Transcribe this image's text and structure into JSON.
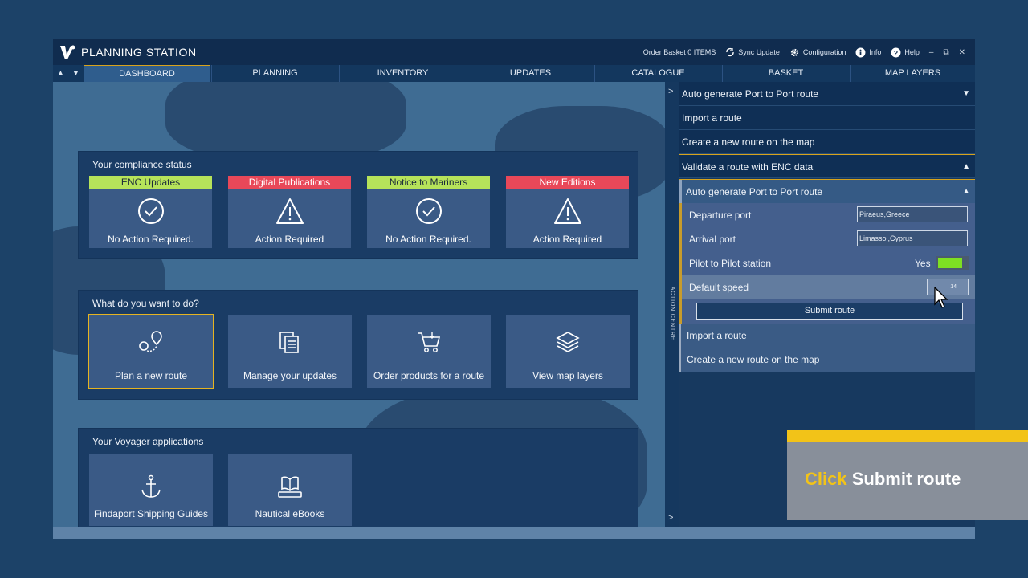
{
  "app": {
    "title": "PLANNING STATION"
  },
  "titlebar": {
    "order_basket": "Order Basket 0 ITEMS",
    "sync": "Sync Update",
    "config": "Configuration",
    "info": "Info",
    "help": "Help",
    "min": "–",
    "restore": "⧉",
    "close": "✕"
  },
  "tabs": [
    "DASHBOARD",
    "PLANNING",
    "INVENTORY",
    "UPDATES",
    "CATALOGUE",
    "BASKET",
    "MAP LAYERS"
  ],
  "compliance": {
    "title": "Your compliance status",
    "items": [
      {
        "header": "ENC Updates",
        "status": "No Action Required.",
        "level": "ok"
      },
      {
        "header": "Digital Publications",
        "status": "Action Required",
        "level": "warn"
      },
      {
        "header": "Notice to Mariners",
        "status": "No Action Required.",
        "level": "ok"
      },
      {
        "header": "New Editions",
        "status": "Action Required",
        "level": "warn"
      }
    ]
  },
  "actions": {
    "title": "What do you want to do?",
    "items": [
      "Plan a new route",
      "Manage your updates",
      "Order products for a route",
      "View map layers"
    ]
  },
  "apps": {
    "title": "Your Voyager applications",
    "items": [
      "Findaport Shipping Guides",
      "Nautical eBooks"
    ]
  },
  "action_centre": {
    "label": "ACTION CENTRE",
    "arrow_top": ">",
    "arrow_bottom": ">"
  },
  "right_panel": {
    "auto_generate": "Auto generate Port to Port route",
    "import": "Import a route",
    "create": "Create a new route on the map",
    "validate": "Validate a route with ENC data",
    "sub_auto": "Auto generate Port to Port route",
    "departure_label": "Departure port",
    "departure_value": "Piraeus,Greece",
    "arrival_label": "Arrival port",
    "arrival_value": "Limassol,Cyprus",
    "pilot_label": "Pilot to Pilot station",
    "pilot_value": "Yes",
    "speed_label": "Default speed",
    "speed_value": "14",
    "submit": "Submit route",
    "sub_import": "Import a route",
    "sub_create": "Create a new route on the map"
  },
  "caption": {
    "click": "Click",
    "rest": "Submit route"
  },
  "colors": {
    "ok": "#b6e35a",
    "warn": "#e84859",
    "accent": "#f2c318",
    "toggle_on": "#7ee022"
  }
}
